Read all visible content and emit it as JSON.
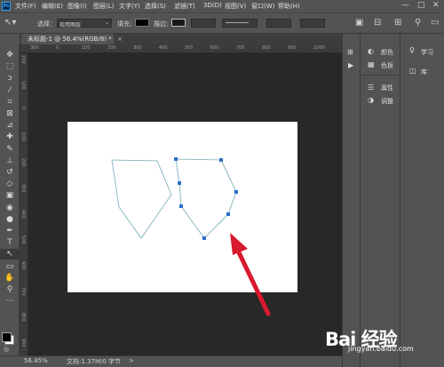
{
  "app": {
    "logo_text": "Ps"
  },
  "menu": {
    "items": [
      "文件(F)",
      "编辑(E)",
      "图像(I)",
      "图层(L)",
      "文字(Y)",
      "选择(S)",
      "滤镜(T)",
      "3D(D)",
      "视图(V)",
      "窗口(W)",
      "帮助(H)"
    ],
    "window_controls": [
      "—",
      "□",
      "✕"
    ]
  },
  "options_bar": {
    "select_label": "选择：",
    "select_value": "现用图层",
    "fill_label": "填充：",
    "stroke_label": "描边：",
    "fill_color": "#000000",
    "stroke_color": "#1a1a1a"
  },
  "document": {
    "tab_title": "未标题-1 @ 56.4%(RGB/8) *",
    "close_glyph": "×"
  },
  "rulers": {
    "top_ticks": [
      "300",
      "0",
      "100",
      "200",
      "300",
      "400",
      "500",
      "600",
      "700",
      "800",
      "900",
      "1000"
    ],
    "left_ticks": [
      "200",
      "100",
      "0",
      "100",
      "200",
      "300",
      "400",
      "500",
      "600",
      "700",
      "800",
      "900"
    ]
  },
  "toolbox": {
    "tools": [
      {
        "name": "move-tool-icon",
        "glyph": "✥"
      },
      {
        "name": "marquee-tool-icon",
        "glyph": "⬚"
      },
      {
        "name": "lasso-tool-icon",
        "glyph": "ↄ"
      },
      {
        "name": "magic-wand-tool-icon",
        "glyph": "⁄"
      },
      {
        "name": "crop-tool-icon",
        "glyph": "⌗"
      },
      {
        "name": "frame-tool-icon",
        "glyph": "⊠"
      },
      {
        "name": "eyedropper-tool-icon",
        "glyph": "⊿"
      },
      {
        "name": "healing-brush-tool-icon",
        "glyph": "✚"
      },
      {
        "name": "brush-tool-icon",
        "glyph": "✎"
      },
      {
        "name": "clone-stamp-tool-icon",
        "glyph": "⊥"
      },
      {
        "name": "history-brush-tool-icon",
        "glyph": "↺"
      },
      {
        "name": "eraser-tool-icon",
        "glyph": "◇"
      },
      {
        "name": "gradient-tool-icon",
        "glyph": "▣"
      },
      {
        "name": "blur-tool-icon",
        "glyph": "◉"
      },
      {
        "name": "dodge-tool-icon",
        "glyph": "●"
      },
      {
        "name": "pen-tool-icon",
        "glyph": "✒"
      },
      {
        "name": "type-tool-icon",
        "glyph": "T"
      },
      {
        "name": "path-selection-tool-icon",
        "glyph": "↖"
      },
      {
        "name": "shape-tool-icon",
        "glyph": "▭"
      },
      {
        "name": "hand-tool-icon",
        "glyph": "✋"
      },
      {
        "name": "zoom-tool-icon",
        "glyph": "⚲"
      },
      {
        "name": "more-tools-icon",
        "glyph": "⋯"
      }
    ],
    "active_tool_index": 17,
    "foreground_color": "#000000",
    "background_color": "#ffffff"
  },
  "status": {
    "zoom": "56.45%",
    "doc_info": "文档:1.37M/0 字节",
    "arrow": ">"
  },
  "panels": {
    "col1": [
      {
        "icon": "color-wheel-icon",
        "glyph": "◐",
        "label": "颜色"
      },
      {
        "icon": "swatches-icon",
        "glyph": "▦",
        "label": "色板"
      },
      {
        "icon": "properties-icon",
        "glyph": "☰",
        "label": "属性"
      },
      {
        "icon": "adjustments-icon",
        "glyph": "◑",
        "label": "调整"
      }
    ],
    "col2": [
      {
        "icon": "learn-icon",
        "glyph": "♀",
        "label": "学习"
      },
      {
        "icon": "library-icon",
        "glyph": "◫",
        "label": "库"
      }
    ],
    "strip": [
      {
        "icon": "history-panel-icon",
        "glyph": "⊞"
      },
      {
        "icon": "play-action-icon",
        "glyph": "▶"
      }
    ]
  },
  "canvas": {
    "background": "#ffffff",
    "path_color": "#6fa8b3",
    "anchor_color": "#2a6fc4",
    "arrow_color": "#d8192e"
  },
  "watermark": {
    "brand": "Bai 经验",
    "url": "jingyan.baidu.com"
  }
}
